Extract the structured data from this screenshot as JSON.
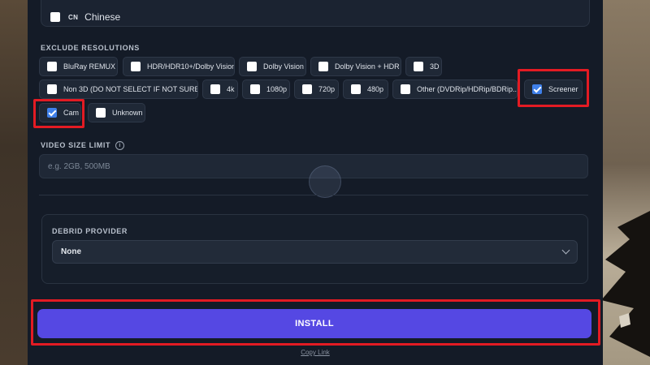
{
  "languages": {
    "chinese": {
      "flag": "CN",
      "label": "Chinese",
      "checked": false
    }
  },
  "exclude_resolutions": {
    "title": "EXCLUDE RESOLUTIONS",
    "options": [
      {
        "label": "BluRay REMUX",
        "checked": false
      },
      {
        "label": "HDR/HDR10+/Dolby Vision",
        "checked": false
      },
      {
        "label": "Dolby Vision",
        "checked": false
      },
      {
        "label": "Dolby Vision + HDR",
        "checked": false
      },
      {
        "label": "3D",
        "checked": false
      },
      {
        "label": "Non 3D (DO NOT SELECT IF NOT SURE)",
        "checked": false
      },
      {
        "label": "4k",
        "checked": false
      },
      {
        "label": "1080p",
        "checked": false
      },
      {
        "label": "720p",
        "checked": false
      },
      {
        "label": "480p",
        "checked": false
      },
      {
        "label": "Other (DVDRip/HDRip/BDRip...)",
        "checked": false
      },
      {
        "label": "Screener",
        "checked": true
      },
      {
        "label": "Cam",
        "checked": true
      },
      {
        "label": "Unknown",
        "checked": false
      }
    ]
  },
  "video_size_limit": {
    "title": "VIDEO SIZE LIMIT",
    "info_icon": "info-icon",
    "placeholder": "e.g. 2GB, 500MB",
    "value": ""
  },
  "debrid": {
    "title": "DEBRID PROVIDER",
    "selected": "None"
  },
  "install_label": "INSTALL",
  "copy_link_label": "Copy Link",
  "colors": {
    "accent": "#5548e3",
    "highlight": "#e31b23",
    "checkbox_on": "#3f80ea"
  }
}
